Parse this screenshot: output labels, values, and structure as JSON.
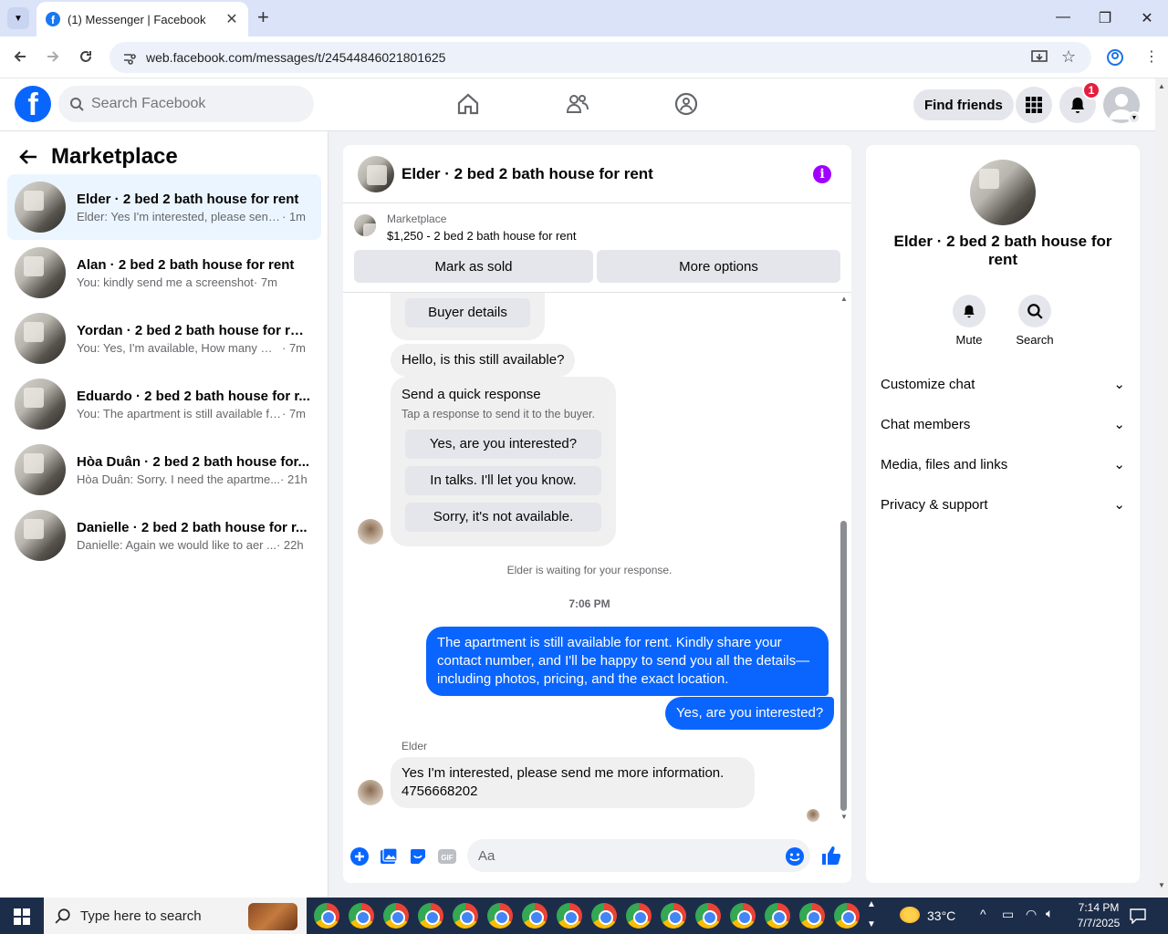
{
  "browser": {
    "tab_title": "(1) Messenger | Facebook",
    "url": "web.facebook.com/messages/t/24544846021801625"
  },
  "header": {
    "search_placeholder": "Search Facebook",
    "find_friends": "Find friends",
    "notification_count": "1"
  },
  "sidebar": {
    "title": "Marketplace",
    "conversations": [
      {
        "name": "Elder · 2 bed 2 bath house for rent",
        "preview": "Elder: Yes I'm interested, please send ...",
        "time": "· 1m",
        "active": true
      },
      {
        "name": "Alan · 2 bed 2 bath house for rent",
        "preview": "You: kindly send me a screenshot",
        "time": "· 7m"
      },
      {
        "name": "Yordan · 2 bed 2 bath house for rent",
        "preview": "You: Yes, I'm available, How many me...",
        "time": "· 7m"
      },
      {
        "name": "Eduardo · 2 bed 2 bath house for r...",
        "preview": "You: The apartment is still available fo...",
        "time": "· 7m"
      },
      {
        "name": "Hòa Duân · 2 bed 2 bath house for...",
        "preview": "Hòa Duân: Sorry. I need the apartme...",
        "time": "· 21h"
      },
      {
        "name": "Danielle · 2 bed 2 bath house for r...",
        "preview": "Danielle: Again we would like to aer ...",
        "time": "· 22h"
      }
    ]
  },
  "chat": {
    "title": "Elder · 2 bed 2 bath house for rent",
    "marketplace_label": "Marketplace",
    "listing": "$1,250 - 2 bed 2 bath house for rent",
    "mark_sold": "Mark as sold",
    "more_options": "More options",
    "buyer_details": "Buyer details",
    "msg_available": "Hello, is this still available?",
    "quick_title": "Send a quick response",
    "quick_sub": "Tap a response to send it to the buyer.",
    "quick_responses": [
      "Yes, are you interested?",
      "In talks. I'll let you know.",
      "Sorry, it's not available."
    ],
    "waiting": "Elder is waiting for your response.",
    "timestamp": "7:06 PM",
    "out_msg_1": "The apartment is still available for rent. Kindly share your contact number, and I'll be happy to send you all the details—including photos, pricing, and the exact location.",
    "out_msg_2": "Yes, are you interested?",
    "sender": "Elder",
    "in_msg_line1": "Yes I'm interested, please send me more information.",
    "in_msg_line2": "4756668202",
    "composer_placeholder": "Aa"
  },
  "details": {
    "title": "Elder · 2 bed 2 bath house for rent",
    "mute": "Mute",
    "search": "Search",
    "sections": [
      "Customize chat",
      "Chat members",
      "Media, files and links",
      "Privacy & support"
    ]
  },
  "taskbar": {
    "search_placeholder": "Type here to search",
    "temperature": "33°C",
    "time": "7:14 PM",
    "date": "7/7/2025"
  }
}
